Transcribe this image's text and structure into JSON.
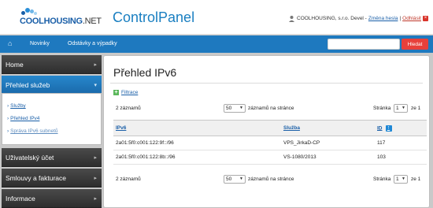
{
  "brand": {
    "logo_main": "COOLHOUSING",
    "logo_suffix": ".NET",
    "app_title": "ControlPanel"
  },
  "user": {
    "name": "COOLHOUSING, s.r.o. Devel -",
    "change_password": "Změna hesla",
    "logout": "Odhlásit"
  },
  "nav": {
    "items": [
      "Novinky",
      "Odstávky a výpadky"
    ],
    "search_placeholder": "",
    "search_button": "Hledat"
  },
  "sidebar": {
    "sections": [
      {
        "label": "Home",
        "active": false
      },
      {
        "label": "Přehled služeb",
        "active": true
      },
      {
        "label": "Uživatelský účet",
        "active": false
      },
      {
        "label": "Smlouvy a fakturace",
        "active": false
      },
      {
        "label": "Informace",
        "active": false
      }
    ],
    "sub_items": [
      "Služby",
      "Přehled IPv4",
      "Správa IPv6 subnetů"
    ]
  },
  "main": {
    "title": "Přehled IPv6",
    "filter_label": "Filtrace",
    "pager": {
      "count": "2 záznamů",
      "per_page": "50",
      "per_page_label": "záznamů na stránce",
      "page_label": "Stránka",
      "page": "1",
      "page_of": "ze 1"
    },
    "table": {
      "headers": [
        "IPv6",
        "Služba",
        "ID"
      ],
      "rows": [
        [
          "2a01:5f0:c001:122:9f::/96",
          "VPS_JirkaD-CP",
          "117"
        ],
        [
          "2a01:5f0:c001:122:8b::/96",
          "VS-1080/2013",
          "103"
        ]
      ]
    }
  },
  "colors": {
    "accent": "#1e79bf",
    "danger": "#e8403b",
    "sidebar_dark": "#3a3a3a"
  }
}
